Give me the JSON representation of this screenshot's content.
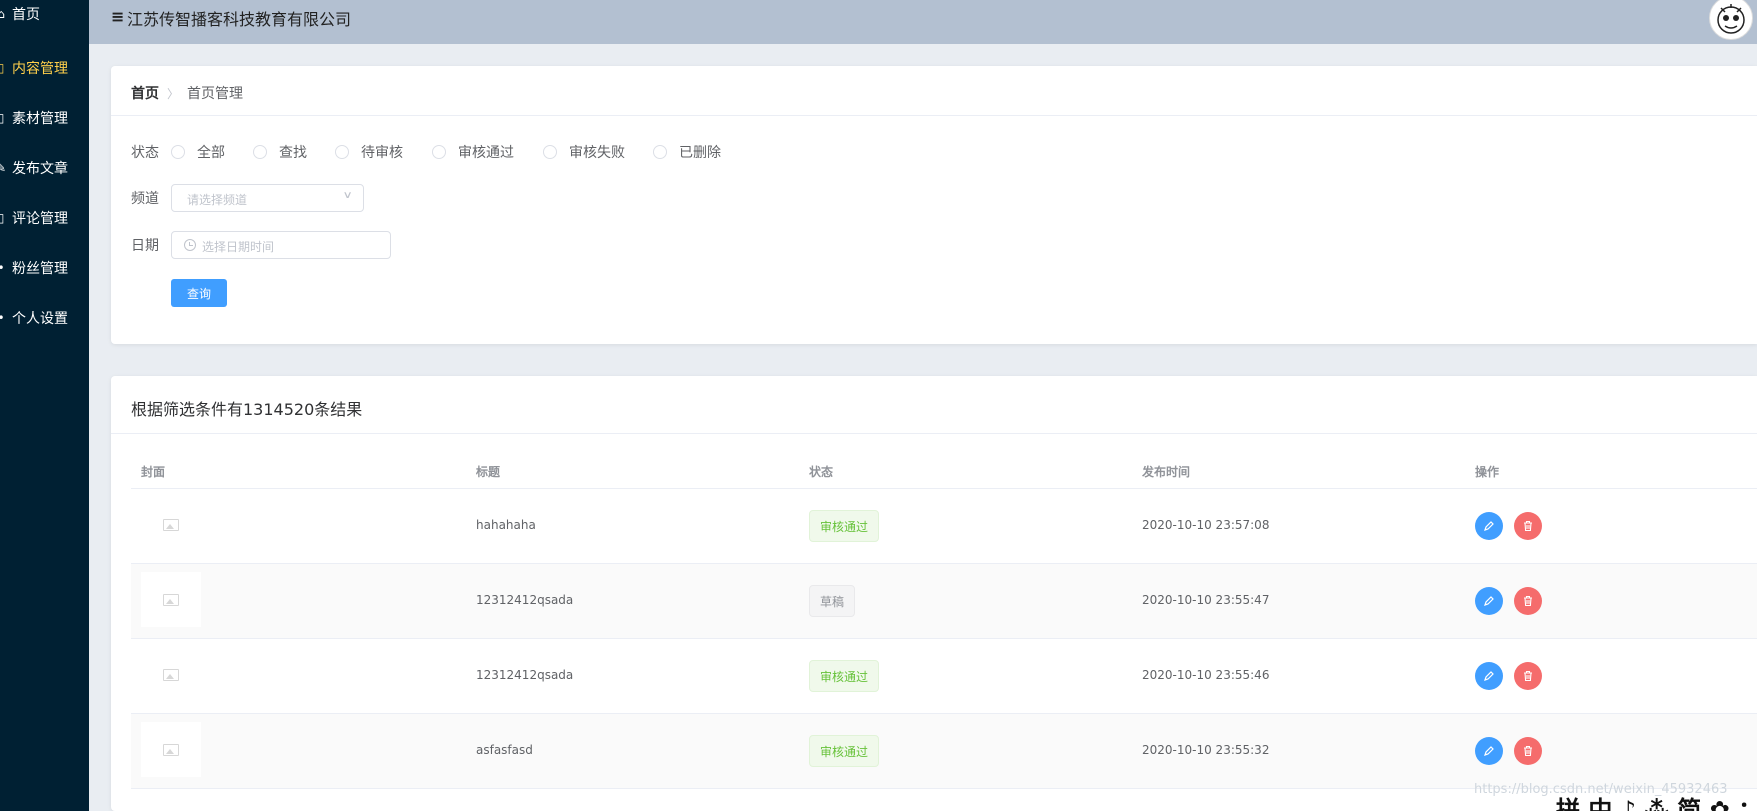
{
  "sidebar": {
    "items": [
      {
        "label": "首页",
        "icon": "home-icon",
        "glyph": "⌂",
        "active": false
      },
      {
        "label": "内容管理",
        "icon": "document-icon",
        "glyph": "▯",
        "active": true
      },
      {
        "label": "素材管理",
        "icon": "picture-icon",
        "glyph": "▯",
        "active": false
      },
      {
        "label": "发布文章",
        "icon": "edit-icon",
        "glyph": "✎",
        "active": false
      },
      {
        "label": "评论管理",
        "icon": "chat-icon",
        "glyph": "▯",
        "active": false
      },
      {
        "label": "粉丝管理",
        "icon": "user-icon",
        "glyph": "•",
        "active": false
      },
      {
        "label": "个人设置",
        "icon": "setting-icon",
        "glyph": "•",
        "active": false
      }
    ]
  },
  "header": {
    "menu_glyph": "≡",
    "company": "江苏传智播客科技教育有限公司"
  },
  "breadcrumb": {
    "home": "首页",
    "separator": "〉",
    "current": "首页管理"
  },
  "filter": {
    "status_label": "状态",
    "status_options": [
      "全部",
      "查找",
      "待审核",
      "审核通过",
      "审核失败",
      "已删除"
    ],
    "channel_label": "频道",
    "channel_placeholder": "请选择频道",
    "channel_arrow": "∨",
    "date_label": "日期",
    "date_placeholder": "选择日期时间",
    "query_button": "查询"
  },
  "result": {
    "title": "根据筛选条件有1314520条结果"
  },
  "table": {
    "headers": [
      "封面",
      "标题",
      "状态",
      "发布时间",
      "操作"
    ],
    "rows": [
      {
        "title": "hahahaha",
        "status": "审核通过",
        "status_type": "success",
        "time": "2020-10-10 23:57:08"
      },
      {
        "title": "12312412qsada",
        "status": "草稿",
        "status_type": "info",
        "time": "2020-10-10 23:55:47"
      },
      {
        "title": "12312412qsada",
        "status": "审核通过",
        "status_type": "success",
        "time": "2020-10-10 23:55:46"
      },
      {
        "title": "asfasfasd",
        "status": "审核通过",
        "status_type": "success",
        "time": "2020-10-10 23:55:32"
      }
    ]
  },
  "watermark": "https://blog.csdn.net/weixin_45932463",
  "ime_bar": "拼 中 ♪ ⁂ 简 ✿ ："
}
